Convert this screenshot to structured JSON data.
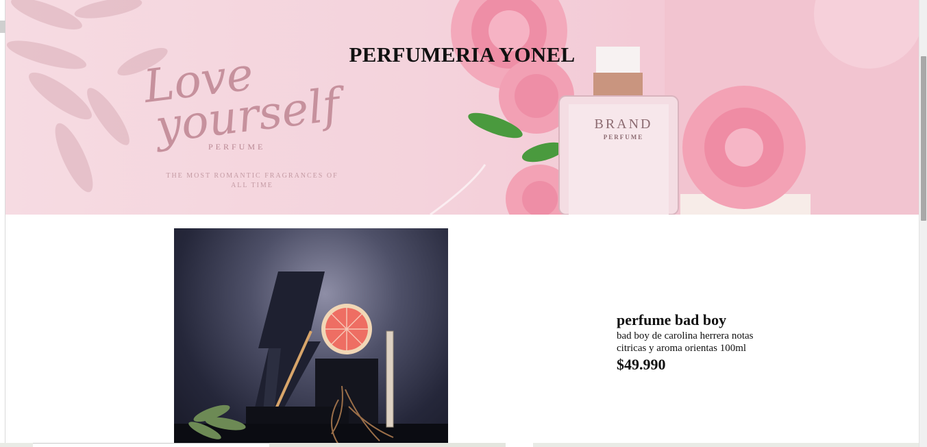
{
  "header": {
    "title": "PERFUMERIA YONEL"
  },
  "banner": {
    "script_line1": "Love",
    "script_line2": "yourself",
    "perfume_label": "PERFUME",
    "tagline": "THE MOST ROMANTIC FRAGRANCES OF ALL TIME",
    "bottle_brand": "BRAND",
    "bottle_sub": "PERFUME",
    "colors": {
      "background": "#f4d3dc",
      "rose": "#ef8fa8",
      "leaf": "#4a9a3e"
    }
  },
  "product": {
    "image_icon": "perfume-bottle-image",
    "name": "perfume bad boy",
    "description": "bad boy de carolina herrera notas citricas y aroma orientas 100ml",
    "price": "$49.990"
  }
}
